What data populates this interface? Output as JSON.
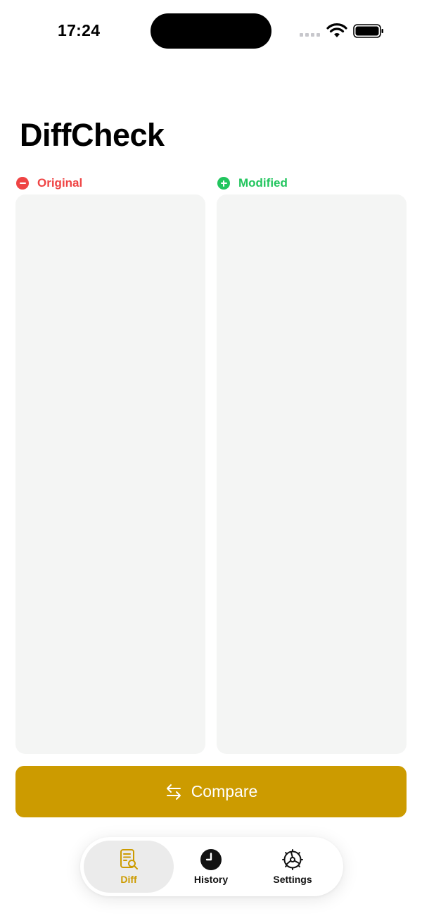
{
  "status_bar": {
    "time": "17:24"
  },
  "app": {
    "title": "DiffCheck"
  },
  "panels": {
    "original": {
      "label": "Original",
      "value": ""
    },
    "modified": {
      "label": "Modified",
      "value": ""
    }
  },
  "compare_button": {
    "label": "Compare",
    "icon": "arrows-left-right-icon"
  },
  "tabs": [
    {
      "label": "Diff",
      "icon": "document-search-icon",
      "selected": true
    },
    {
      "label": "History",
      "icon": "clock-icon",
      "selected": false
    },
    {
      "label": "Settings",
      "icon": "gear-icon",
      "selected": false
    }
  ],
  "colors": {
    "accent": "#cc9b00",
    "original": "#ef4444",
    "modified": "#22c55e",
    "panel_bg": "#f4f5f4"
  }
}
